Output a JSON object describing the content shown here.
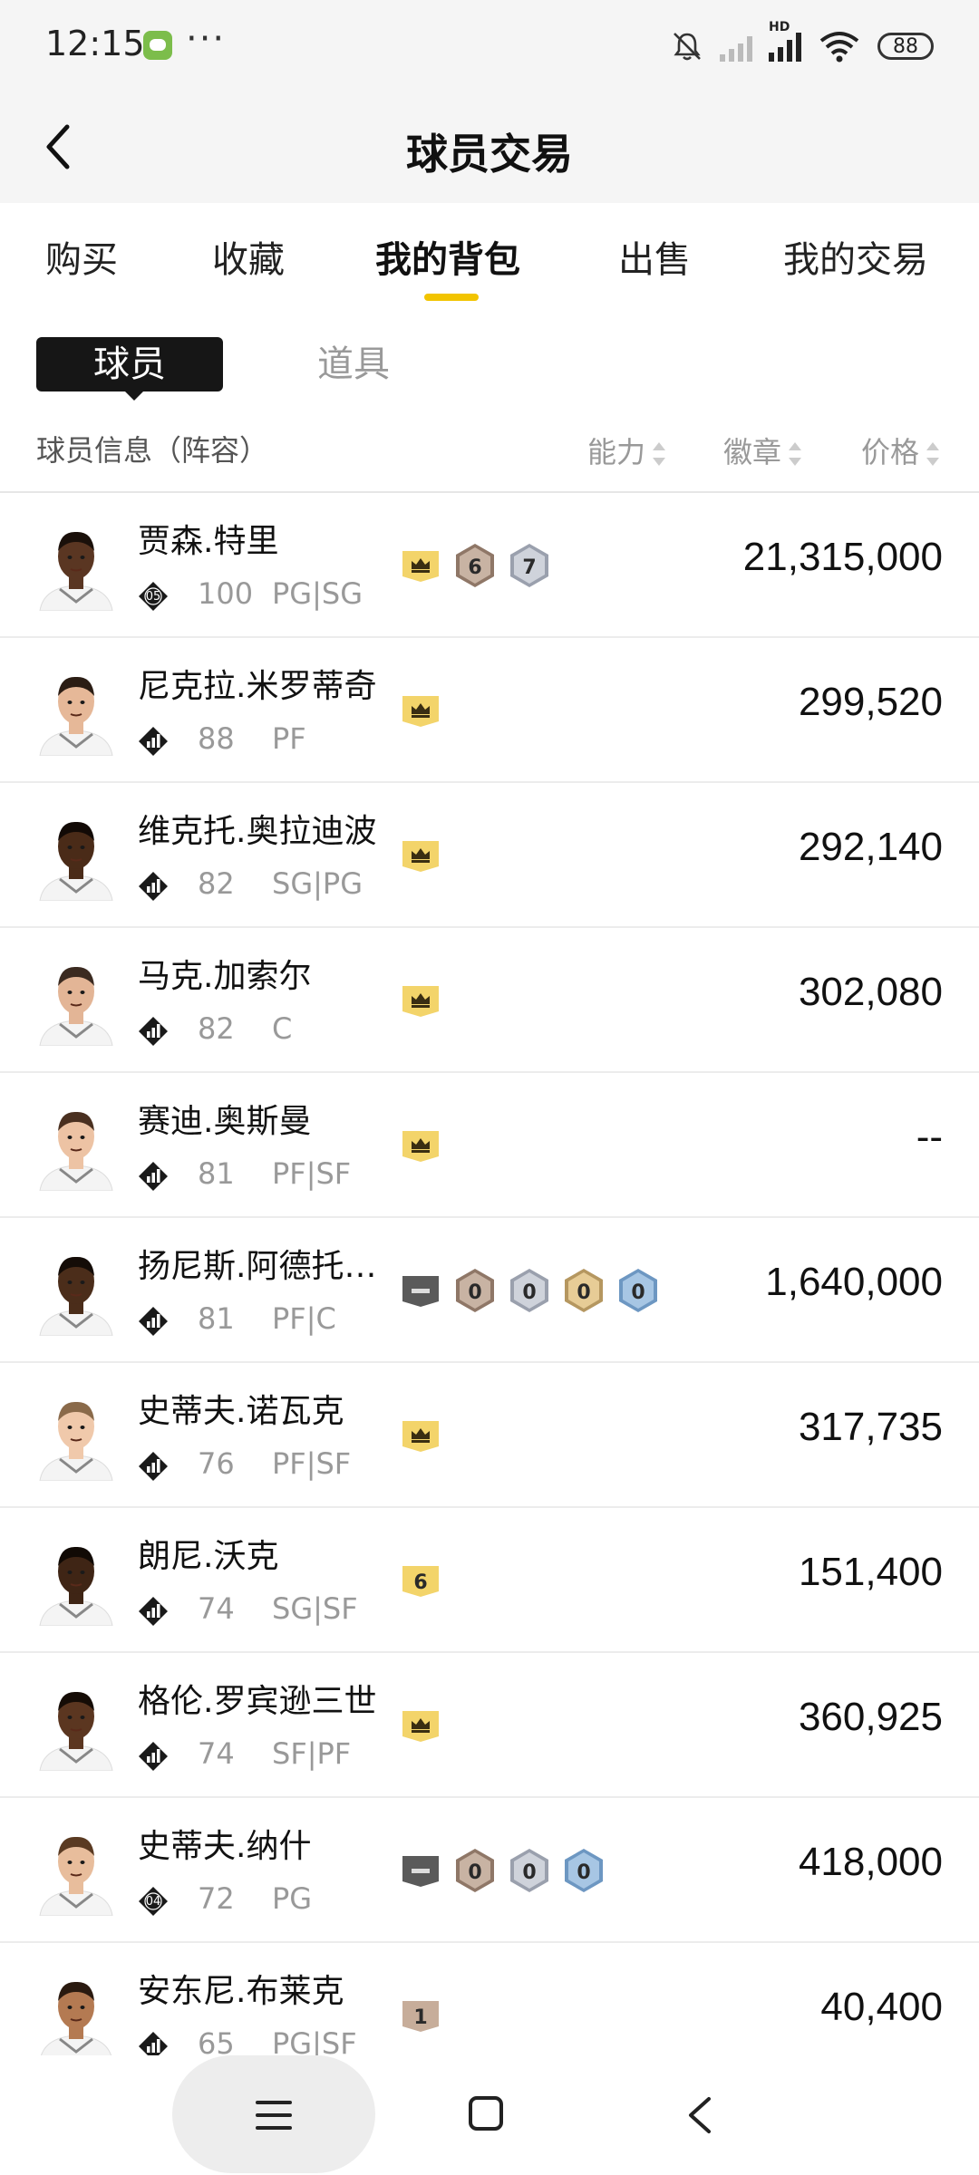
{
  "status_bar": {
    "time": "12:15",
    "more": "···",
    "hd": "HD",
    "battery": "88",
    "icons": [
      "wechat-icon",
      "bell-muted-icon",
      "signal-icon",
      "signal-hd-icon",
      "wifi-icon",
      "battery-icon"
    ]
  },
  "header": {
    "title": "球员交易",
    "back_icon": "chevron-left-icon"
  },
  "tabs": [
    {
      "label": "购买"
    },
    {
      "label": "收藏"
    },
    {
      "label": "我的背包",
      "active": true
    },
    {
      "label": "出售"
    },
    {
      "label": "我的交易"
    }
  ],
  "segments": {
    "active": "球员",
    "inactive": "道具"
  },
  "columns": {
    "info": "球员信息（阵容）",
    "ability": "能力",
    "badge": "徽章",
    "price": "价格"
  },
  "accent_color": "#f2c400",
  "players": [
    {
      "name": "贾森.特里",
      "level": "05",
      "ability": "100",
      "position": "PG|SG",
      "price": "21,315,000",
      "badges": [
        {
          "type": "crown"
        },
        {
          "type": "hex-bronze",
          "label": "6"
        },
        {
          "type": "hex-silver",
          "label": "7"
        }
      ],
      "skin": "#5a3622",
      "hair": "#1a100a"
    },
    {
      "name": "尼克拉.米罗蒂奇",
      "level": "",
      "ability": "88",
      "position": "PF",
      "price": "299,520",
      "badges": [
        {
          "type": "crown"
        }
      ],
      "skin": "#e6b898",
      "hair": "#2b1d14"
    },
    {
      "name": "维克托.奥拉迪波",
      "level": "",
      "ability": "82",
      "position": "SG|PG",
      "price": "292,140",
      "badges": [
        {
          "type": "crown"
        }
      ],
      "skin": "#4a2b18",
      "hair": "#120a06"
    },
    {
      "name": "马克.加索尔",
      "level": "",
      "ability": "82",
      "position": "C",
      "price": "302,080",
      "badges": [
        {
          "type": "crown"
        }
      ],
      "skin": "#e3b596",
      "hair": "#3b2a20"
    },
    {
      "name": "赛迪.奥斯曼",
      "level": "",
      "ability": "81",
      "position": "PF|SF",
      "price": "--",
      "badges": [
        {
          "type": "crown"
        }
      ],
      "skin": "#edc3a4",
      "hair": "#4a3020"
    },
    {
      "name": "扬尼斯.阿德托…",
      "level": "",
      "ability": "81",
      "position": "PF|C",
      "price": "1,640,000",
      "badges": [
        {
          "type": "dash"
        },
        {
          "type": "hex-bronze",
          "label": "0"
        },
        {
          "type": "hex-silver",
          "label": "0"
        },
        {
          "type": "hex-gold",
          "label": "0"
        },
        {
          "type": "hex-blue",
          "label": "0"
        }
      ],
      "skin": "#4b2d1a",
      "hair": "#140c07"
    },
    {
      "name": "史蒂夫.诺瓦克",
      "level": "",
      "ability": "76",
      "position": "PF|SF",
      "price": "317,735",
      "badges": [
        {
          "type": "crown"
        }
      ],
      "skin": "#f0c9ab",
      "hair": "#8a6a4a"
    },
    {
      "name": "朗尼.沃克",
      "level": "",
      "ability": "74",
      "position": "SG|SF",
      "price": "151,400",
      "badges": [
        {
          "type": "num",
          "label": "6"
        }
      ],
      "skin": "#3f2515",
      "hair": "#110a05"
    },
    {
      "name": "格伦.罗宾逊三世",
      "level": "",
      "ability": "74",
      "position": "SF|PF",
      "price": "360,925",
      "badges": [
        {
          "type": "crown"
        }
      ],
      "skin": "#5b3620",
      "hair": "#150c06"
    },
    {
      "name": "史蒂夫.纳什",
      "level": "04",
      "ability": "72",
      "position": "PG",
      "price": "418,000",
      "badges": [
        {
          "type": "dash"
        },
        {
          "type": "hex-bronze",
          "label": "0"
        },
        {
          "type": "hex-silver",
          "label": "0"
        },
        {
          "type": "hex-blue",
          "label": "0"
        }
      ],
      "skin": "#e8bd9c",
      "hair": "#5a3a22"
    },
    {
      "name": "安东尼.布莱克",
      "level": "",
      "ability": "65",
      "position": "PG|SF",
      "price": "40,400",
      "badges": [
        {
          "type": "num-bronze",
          "label": "1"
        }
      ],
      "skin": "#b47a52",
      "hair": "#2a1a10"
    }
  ],
  "nav": {
    "menu_icon": "menu-icon",
    "home_icon": "home-square-icon",
    "back_icon": "back-triangle-icon"
  }
}
